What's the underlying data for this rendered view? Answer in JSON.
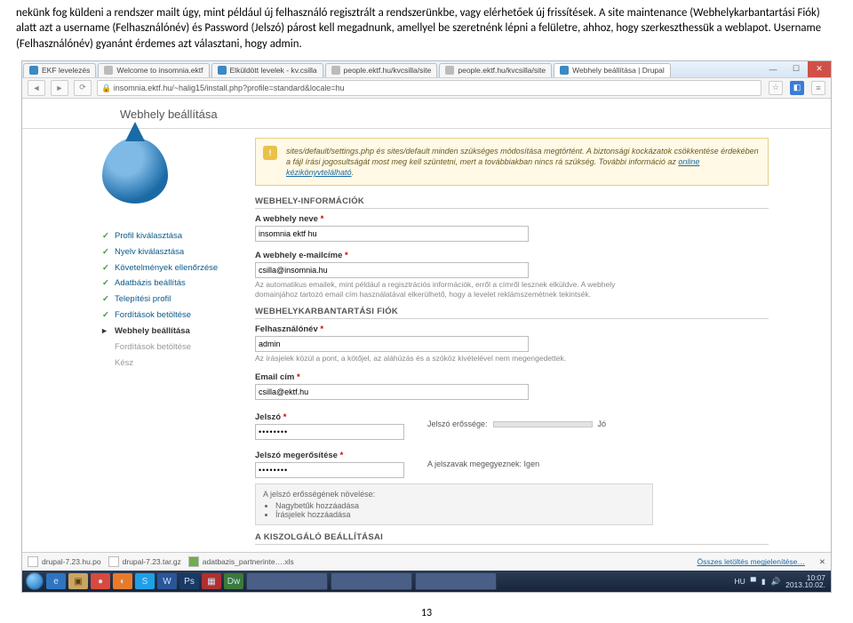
{
  "doc": {
    "paragraph": "nekünk fog küldeni a rendszer mailt úgy, mint például új felhasználó regisztrált a rendszerünkbe, vagy elérhetőek új frissítések. A site maintenance (Webhelykarbantartási Fiók) alatt azt a username (Felhasználónév) és Password (Jelszó) párost kell megadnunk, amellyel be szeretnénk lépni a felületre, ahhoz, hogy szerkeszthessük a weblapot. Username (Felhasználónév) gyanánt érdemes azt választani, hogy admin.",
    "pagenum": "13"
  },
  "tabs": [
    "EKF levelezés",
    "Welcome to insomnia.ektf",
    "Elküldött levelek - kv.csilla",
    "people.ektf.hu/kvcsilla/site",
    "people.ektf.hu/kvcsilla/site",
    "Webhely beállítása | Drupal"
  ],
  "addr": {
    "url": "insomnia.ektf.hu/~halig15/install.php?profile=standard&locale=hu"
  },
  "page": {
    "title": "Webhely beállítása",
    "steps": [
      "Profil kiválasztása",
      "Nyelv kiválasztása",
      "Követelmények ellenőrzése",
      "Adatbázis beállítás",
      "Telepítési profil",
      "Fordítások betöltése",
      "Webhely beállítása",
      "Fordítások betöltése",
      "Kész"
    ],
    "warn": {
      "text": "sites/default/settings.php és sites/default minden szükséges módosítása megtörtént. A biztonsági kockázatok csökkentése érdekében a fájl írási jogosultságát most meg kell szüntetni, mert a továbbiakban nincs rá szükség. További információ az ",
      "link": "online kézikönyvtelálható"
    },
    "info": {
      "head": "WEBHELY-INFORMÁCIÓK",
      "name_label": "A webhely neve",
      "name_value": "insomnia ektf hu",
      "mail_label": "A webhely e-mailcíme",
      "mail_value": "csilla@insomnia.hu",
      "mail_hint": "Az automatikus emailek, mint például a regisztrációs információk, erről a címről lesznek elküldve. A webhely domainjához tartozó email cím használatával elkerülhető, hogy a levelet reklámszemétnek tekintsék."
    },
    "maint": {
      "head": "WEBHELYKARBANTARTÁSI FIÓK",
      "user_label": "Felhasználónév",
      "user_value": "admin",
      "user_hint": "Az írásjelek közül a pont, a kötőjel, az aláhúzás és a szóköz kivételével nem megengedettek.",
      "email_label": "Email cím",
      "email_value": "csilla@ektf.hu",
      "pw_label": "Jelszó",
      "pw_value": "••••••••",
      "pw_strength_label": "Jelszó erőssége:",
      "pw_strength_value": "Jó",
      "pw2_label": "Jelszó megerősítése",
      "pw_match": "A jelszavak megegyeznek: Igen",
      "tips_head": "A jelszó erősségének növelése:",
      "tip1": "Nagybetűk hozzáadása",
      "tip2": "Írásjelek hozzáadása"
    },
    "server": {
      "head": "A KISZOLGÁLÓ BEÁLLÍTÁSAI"
    }
  },
  "shelf": {
    "f1": "drupal-7.23.hu.po",
    "f2": "drupal-7.23.tar.gz",
    "f3": "adatbazis_partnerinte….xls",
    "all": "Összes letöltés megjelenítése…"
  },
  "tray": {
    "lang": "HU",
    "time": "10:07",
    "date": "2013.10.02."
  }
}
